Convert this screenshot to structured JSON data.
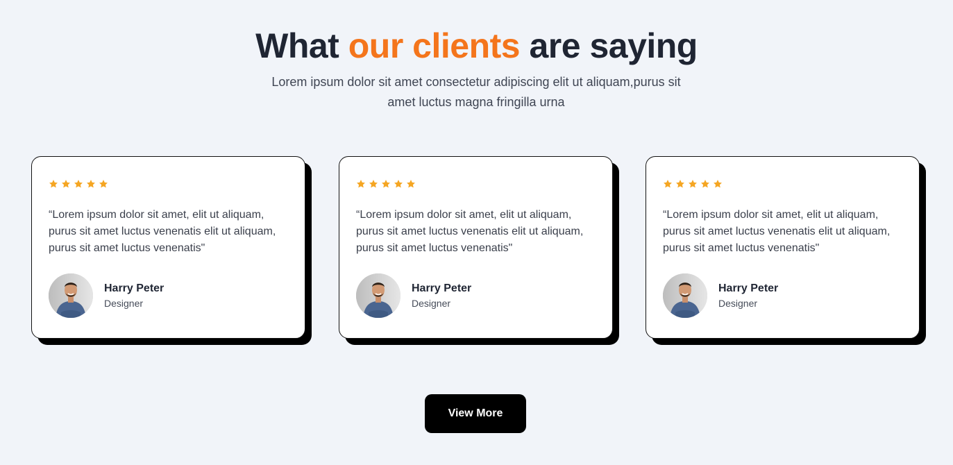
{
  "header": {
    "title_prefix": "What",
    "title_accent": "our clients",
    "title_suffix": "are saying",
    "subtitle": "Lorem ipsum dolor sit amet consectetur adipiscing elit ut aliquam,purus sit amet luctus magna fringilla urna"
  },
  "colors": {
    "accent": "#f4751c",
    "star": "#f5a623",
    "background": "#f1f4f9",
    "button": "#000000"
  },
  "testimonials": [
    {
      "rating": 5,
      "quote": "“Lorem ipsum dolor sit amet, elit ut aliquam, purus sit amet luctus venenatis elit ut aliquam, purus sit amet luctus venenatis\"",
      "name": "Harry Peter",
      "role": "Designer",
      "avatar_icon": "person-avatar"
    },
    {
      "rating": 5,
      "quote": "“Lorem ipsum dolor sit amet, elit ut aliquam, purus sit amet luctus venenatis elit ut aliquam, purus sit amet luctus venenatis\"",
      "name": "Harry Peter",
      "role": "Designer",
      "avatar_icon": "person-avatar"
    },
    {
      "rating": 5,
      "quote": "“Lorem ipsum dolor sit amet, elit ut aliquam, purus sit amet luctus venenatis elit ut aliquam, purus sit amet luctus venenatis\"",
      "name": "Harry Peter",
      "role": "Designer",
      "avatar_icon": "person-avatar"
    }
  ],
  "actions": {
    "view_more_label": "View More"
  }
}
